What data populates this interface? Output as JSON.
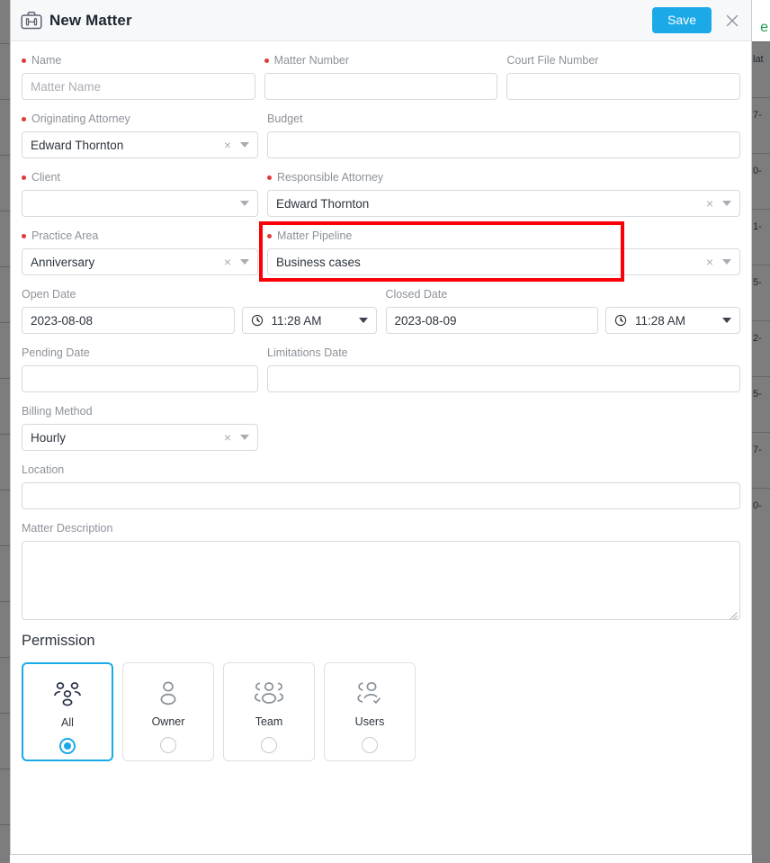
{
  "header": {
    "title": "New Matter",
    "icon": "briefcase-icon",
    "save_label": "Save",
    "close_label": "×",
    "accent_color": "#1ca9e8"
  },
  "background": {
    "green_text": "e",
    "table_cells": [
      "lat",
      "7-",
      "0-",
      "1-",
      "5-",
      "2-",
      "5-",
      "7-",
      "0-"
    ]
  },
  "form": {
    "name": {
      "label": "Name",
      "required": true,
      "value": "",
      "placeholder": "Matter Name"
    },
    "matter_number": {
      "label": "Matter Number",
      "required": true,
      "value": "",
      "placeholder": ""
    },
    "court_file_number": {
      "label": "Court File Number",
      "required": false,
      "value": "",
      "placeholder": ""
    },
    "originating_attorney": {
      "label": "Originating Attorney",
      "required": true,
      "value": "Edward Thornton",
      "clear": "×"
    },
    "budget": {
      "label": "Budget",
      "required": false,
      "value": "",
      "placeholder": ""
    },
    "client": {
      "label": "Client",
      "required": true,
      "value": "",
      "placeholder": ""
    },
    "responsible_attorney": {
      "label": "Responsible Attorney",
      "required": true,
      "value": "Edward Thornton",
      "clear": "×"
    },
    "practice_area": {
      "label": "Practice Area",
      "required": true,
      "value": "Anniversary",
      "clear": "×"
    },
    "matter_pipeline": {
      "label": "Matter Pipeline",
      "required": true,
      "value": "Business cases",
      "clear": "×",
      "highlighted": true,
      "highlight_color": "#fb0007"
    },
    "open_date": {
      "label": "Open Date",
      "required": false,
      "value": "2023-08-08",
      "time_value": "11:28 AM"
    },
    "closed_date": {
      "label": "Closed Date",
      "required": false,
      "value": "2023-08-09",
      "time_value": "11:28 AM"
    },
    "pending_date": {
      "label": "Pending Date",
      "required": false,
      "value": ""
    },
    "limitations_date": {
      "label": "Limitations Date",
      "required": false,
      "value": ""
    },
    "billing_method": {
      "label": "Billing Method",
      "required": false,
      "value": "Hourly",
      "clear": "×"
    },
    "location": {
      "label": "Location",
      "required": false,
      "value": ""
    },
    "matter_description": {
      "label": "Matter Description",
      "required": false,
      "value": ""
    }
  },
  "permission": {
    "title": "Permission",
    "selected": "All",
    "options": [
      {
        "label": "All",
        "icon": "group-all-icon",
        "selected": true
      },
      {
        "label": "Owner",
        "icon": "person-icon",
        "selected": false
      },
      {
        "label": "Team",
        "icon": "team-icon",
        "selected": false
      },
      {
        "label": "Users",
        "icon": "users-check-icon",
        "selected": false
      }
    ]
  }
}
